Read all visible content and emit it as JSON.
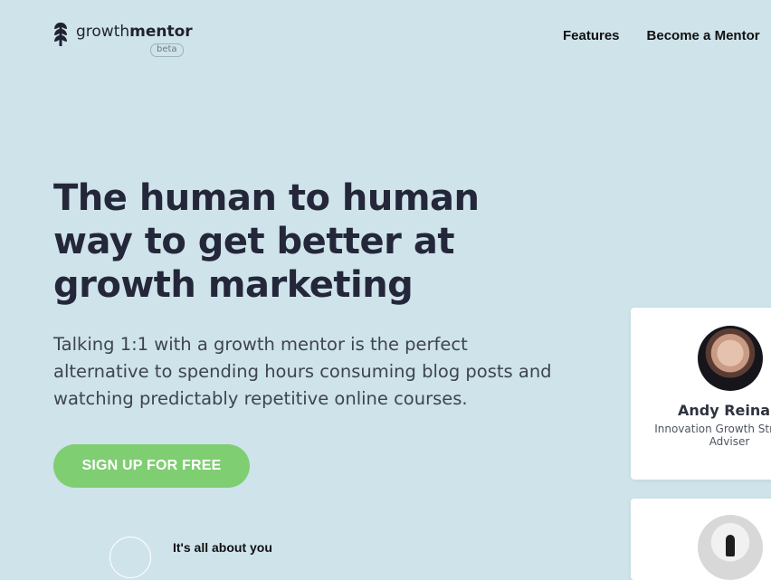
{
  "brand": {
    "name_light": "growth",
    "name_bold": "mentor",
    "badge": "beta"
  },
  "nav": {
    "features": "Features",
    "become_mentor": "Become a Mentor"
  },
  "hero": {
    "title": "The human to human way to get better at growth marketing",
    "subtitle": "Talking 1:1 with a growth mentor is the perfect alternative to spending hours consuming blog posts and watching predictably repetitive online courses.",
    "cta": "SIGN UP FOR FREE"
  },
  "secondary": {
    "heading": "It's all about you"
  },
  "mentor_card": {
    "name": "Andy Reinake",
    "role": "Innovation Growth Stra and Adviser"
  },
  "colors": {
    "background": "#cfe3ea",
    "cta": "#7fce72",
    "heading": "#24273a",
    "card": "#ffffff"
  }
}
